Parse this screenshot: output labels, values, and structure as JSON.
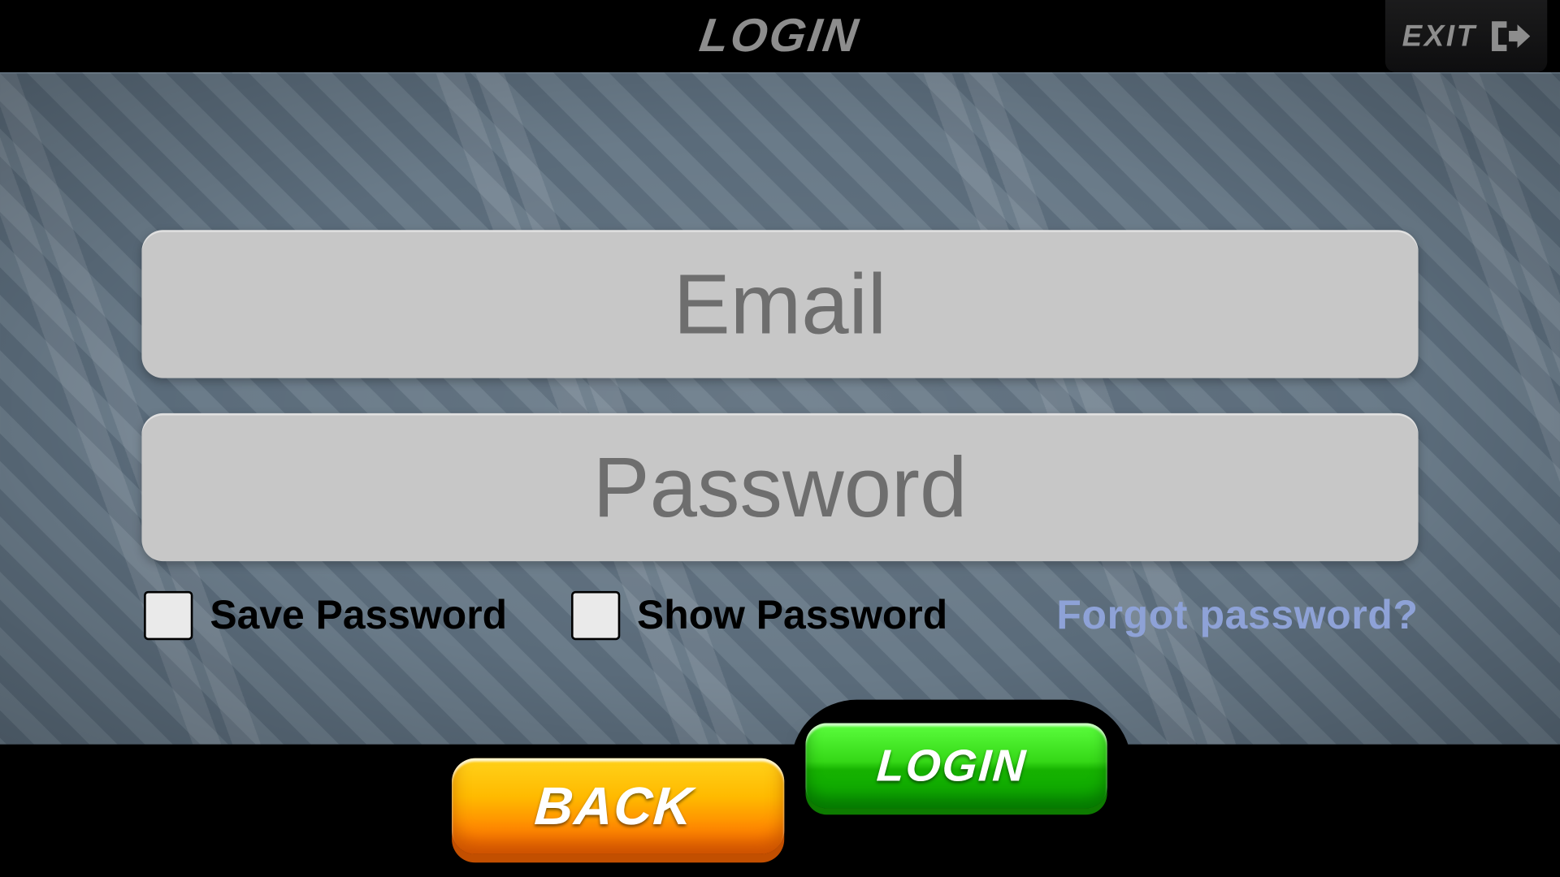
{
  "header": {
    "title": "LOGIN",
    "exit_label": "EXIT"
  },
  "form": {
    "email_placeholder": "Email",
    "password_placeholder": "Password",
    "email_value": "",
    "password_value": "",
    "save_password_label": "Save Password",
    "show_password_label": "Show Password",
    "forgot_password_label": "Forgot password?"
  },
  "buttons": {
    "back_label": "BACK",
    "login_label": "LOGIN"
  },
  "colors": {
    "accent_green": "#16b200",
    "accent_orange": "#ff8e00",
    "link_blue": "#8ea2d7",
    "header_grey": "#8d8d8d"
  }
}
